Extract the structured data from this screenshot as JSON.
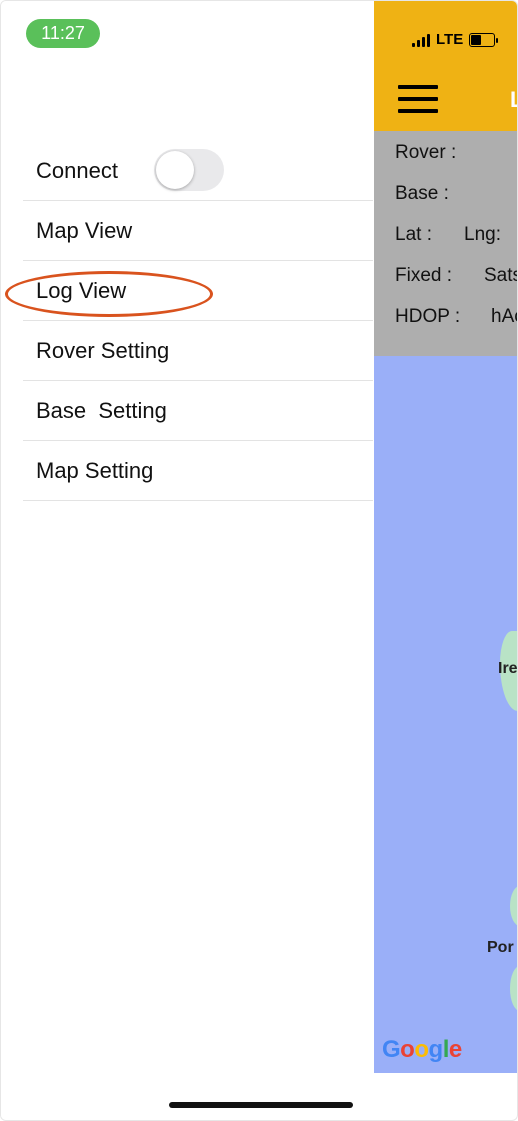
{
  "status_bar": {
    "time": "11:27",
    "network": "LTE"
  },
  "drawer": {
    "connect": {
      "label": "Connect",
      "toggle_on": false
    },
    "items": [
      {
        "label": "Map View"
      },
      {
        "label": "Log View",
        "highlighted": true
      },
      {
        "label": "Rover Setting"
      },
      {
        "label": "Base  Setting"
      },
      {
        "label": "Map Setting"
      }
    ]
  },
  "app_bar": {
    "title_fragment": "L",
    "color": "#efb214"
  },
  "info_panel": {
    "rover": "Rover :",
    "base": "Base :",
    "lat": "Lat :",
    "lng": "Lng:",
    "fixed": "Fixed :",
    "sats": "Sats",
    "hdop": "HDOP :",
    "hacc": "hAc"
  },
  "map": {
    "labels": [
      "Ire",
      "Por"
    ],
    "attribution": [
      "G",
      "o",
      "o",
      "g",
      "l",
      "e"
    ],
    "water_color": "#9aaff8"
  }
}
